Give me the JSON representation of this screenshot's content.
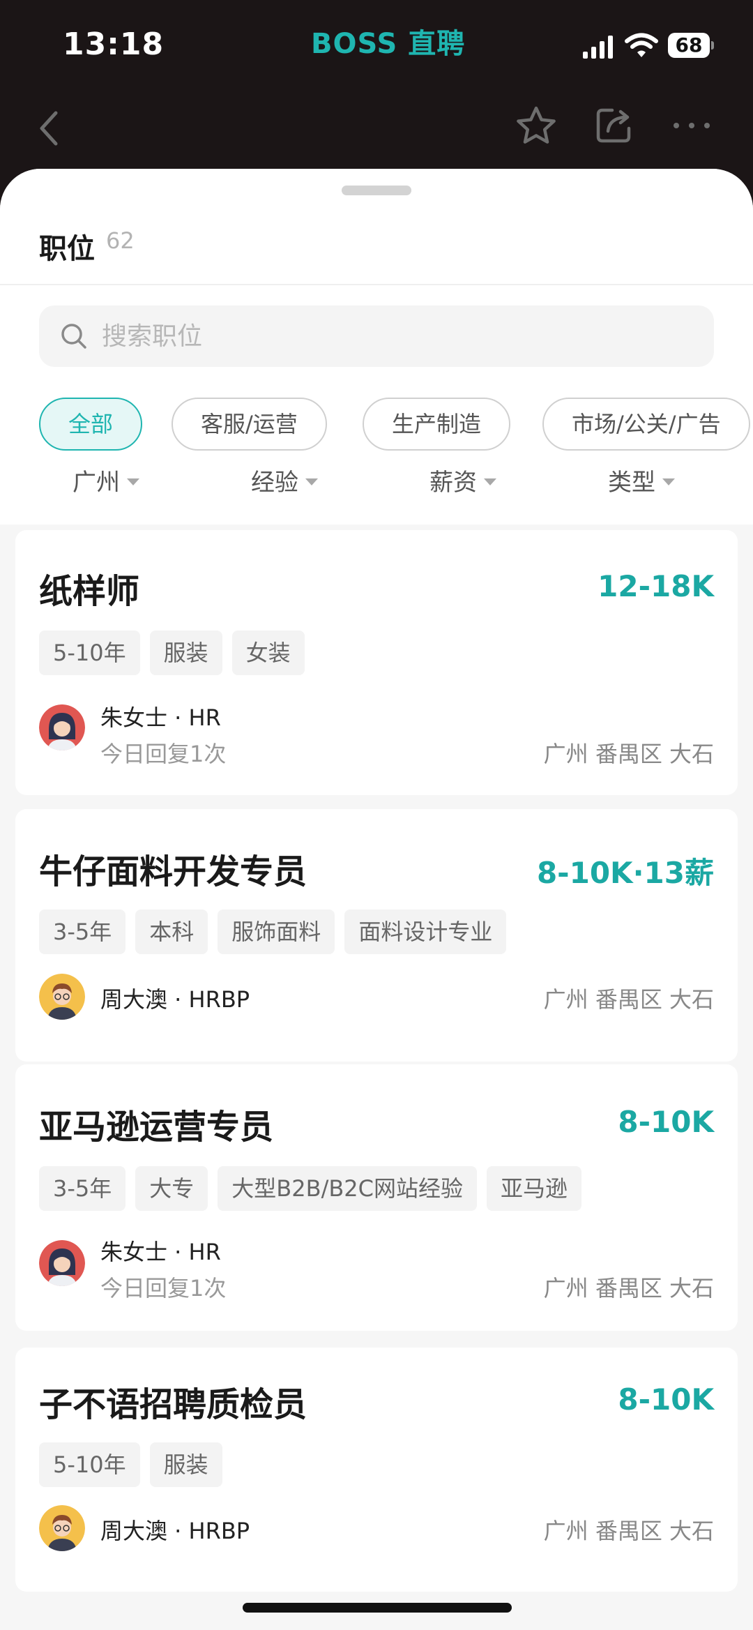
{
  "status_bar": {
    "time": "13:18",
    "brand": "BOSS 直聘",
    "battery": "68"
  },
  "nav": {
    "icons": [
      "back-icon",
      "star-icon",
      "share-icon",
      "more-icon"
    ]
  },
  "sheet": {
    "title": "职位",
    "count": "62",
    "search": {
      "placeholder": "搜索职位"
    },
    "categories": [
      "全部",
      "客服/运营",
      "生产制造",
      "市场/公关/广告"
    ],
    "active_category": "全部",
    "filters": [
      "广州",
      "经验",
      "薪资",
      "类型"
    ]
  },
  "jobs": [
    {
      "title": "纸样师",
      "salary": "12-18K",
      "tags": [
        "5-10年",
        "服装",
        "女装"
      ],
      "recruiter": "朱女士 · HR",
      "reply": "今日回复1次",
      "location": "广州 番禺区 大石"
    },
    {
      "title": "牛仔面料开发专员",
      "salary": "8-10K·13薪",
      "tags": [
        "3-5年",
        "本科",
        "服饰面料",
        "面料设计专业"
      ],
      "recruiter": "周大澳 · HRBP",
      "reply": "",
      "location": "广州 番禺区 大石"
    },
    {
      "title": "亚马逊运营专员",
      "salary": "8-10K",
      "tags": [
        "3-5年",
        "大专",
        "大型B2B/B2C网站经验",
        "亚马逊"
      ],
      "recruiter": "朱女士 · HR",
      "reply": "今日回复1次",
      "location": "广州 番禺区 大石"
    },
    {
      "title": "子不语招聘质检员",
      "salary": "8-10K",
      "tags": [
        "5-10年",
        "服装"
      ],
      "recruiter": "周大澳 · HRBP",
      "reply": "",
      "location": "广州 番禺区 大石"
    }
  ],
  "colors": {
    "accent": "#1fb5b0",
    "salary": "#1ba8a3",
    "header_bg": "#1b1516"
  }
}
